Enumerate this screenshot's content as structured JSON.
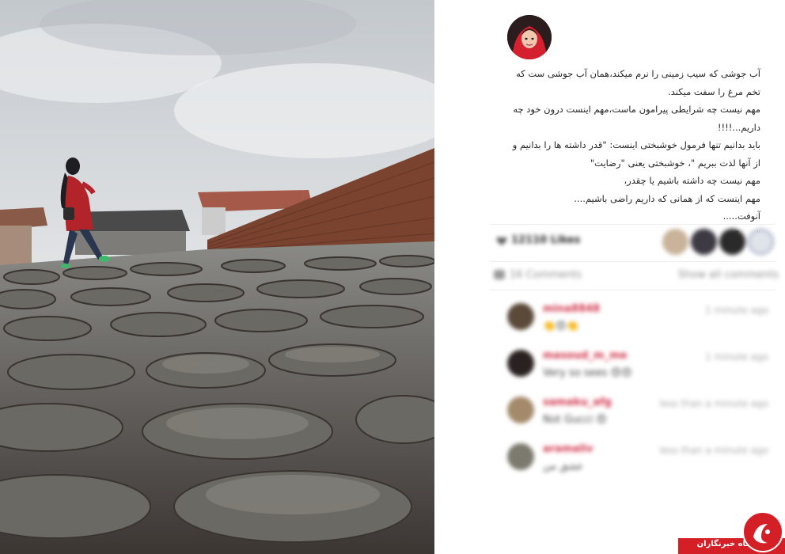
{
  "caption": {
    "lines": [
      "آب جوشی که سیب زمینی را نرم میکند،همان آب جوشی ست که",
      "تخم مرغ را سفت میکند.",
      "مهم نیست چه شرایطی پیرامون ماست،مهم اینست درون خود چه",
      "داریم...!!!!",
      "باید بدانیم تنها فرمول خوشبختی اینست: \"قدر داشته ها را بدانیم و",
      "از آنها لذت ببریم \"، خوشبختی یعنی \"رضایت\"",
      "مهم نیست چه داشته باشیم یا چقدر،",
      "مهم اینست که از همانی که داریم راضی باشیم....",
      "آنوفت.....",
      "\"......\""
    ]
  },
  "likes": {
    "count_label": "12110 Likes"
  },
  "comments_bar": {
    "count_label": "16 Comments",
    "show_all_label": "Show all comments"
  },
  "comments": [
    {
      "user": "mina8848",
      "text": "👏😍👏",
      "time": "1 minute ago"
    },
    {
      "user": "masoud_m_me",
      "text": "Very so sees 😍😍",
      "time": "1 minute ago"
    },
    {
      "user": "samaku_afg",
      "text": "Not Gucci 😍",
      "time": "less than a minute ago"
    },
    {
      "user": "aramaliv",
      "text": "عشق من",
      "time": "less than a minute ago"
    }
  ],
  "watermark": {
    "text": "باشگاه خبرنگاران"
  },
  "colors": {
    "username": "#d0344a",
    "watermark": "#d41f26"
  },
  "icons": {
    "likes": "heart-icon",
    "comments": "comment-icon"
  }
}
